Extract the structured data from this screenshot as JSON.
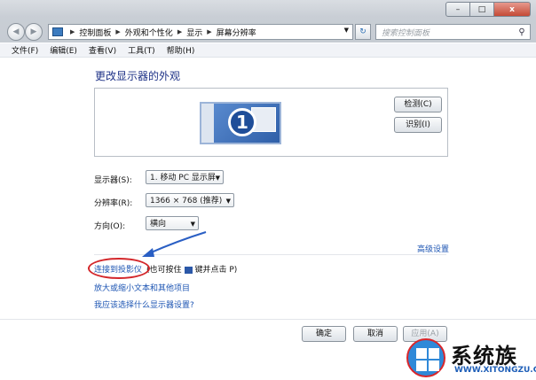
{
  "window": {
    "controls": {
      "minimize": "–",
      "maximize": "□",
      "close": "x"
    }
  },
  "nav": {
    "back": "◀",
    "forward": "▶",
    "breadcrumbs": [
      "控制面板",
      "外观和个性化",
      "显示",
      "屏幕分辨率"
    ],
    "search_placeholder": "搜索控制面板",
    "refresh": "↻"
  },
  "menu": [
    "文件(F)",
    "编辑(E)",
    "查看(V)",
    "工具(T)",
    "帮助(H)"
  ],
  "content": {
    "title": "更改显示器的外观",
    "monitor_number": "1",
    "detect_button": "检测(C)",
    "identify_button": "识别(I)",
    "display_label": "显示器(S):",
    "display_value": "1. 移动 PC 显示屏",
    "resolution_label": "分辨率(R):",
    "resolution_value": "1366 × 768 (推荐)",
    "orientation_label": "方向(O):",
    "orientation_value": "横向",
    "advanced_link": "高级设置",
    "projector_link": "连接到投影仪",
    "projector_hint_pre": "(也可按住",
    "projector_hint_post": "键并点击 P)",
    "textsize_link": "放大或缩小文本和其他项目",
    "which_link": "我应该选择什么显示器设置?"
  },
  "footer": {
    "ok": "确定",
    "cancel": "取消",
    "apply": "应用(A)"
  },
  "watermark": {
    "name": "系统族",
    "url": "WWW.XITONGZU.COM"
  },
  "colors": {
    "link": "#1d55b3",
    "title": "#1e3287",
    "annotation_red": "#d3262a",
    "annotation_arrow": "#2a5fc4"
  }
}
